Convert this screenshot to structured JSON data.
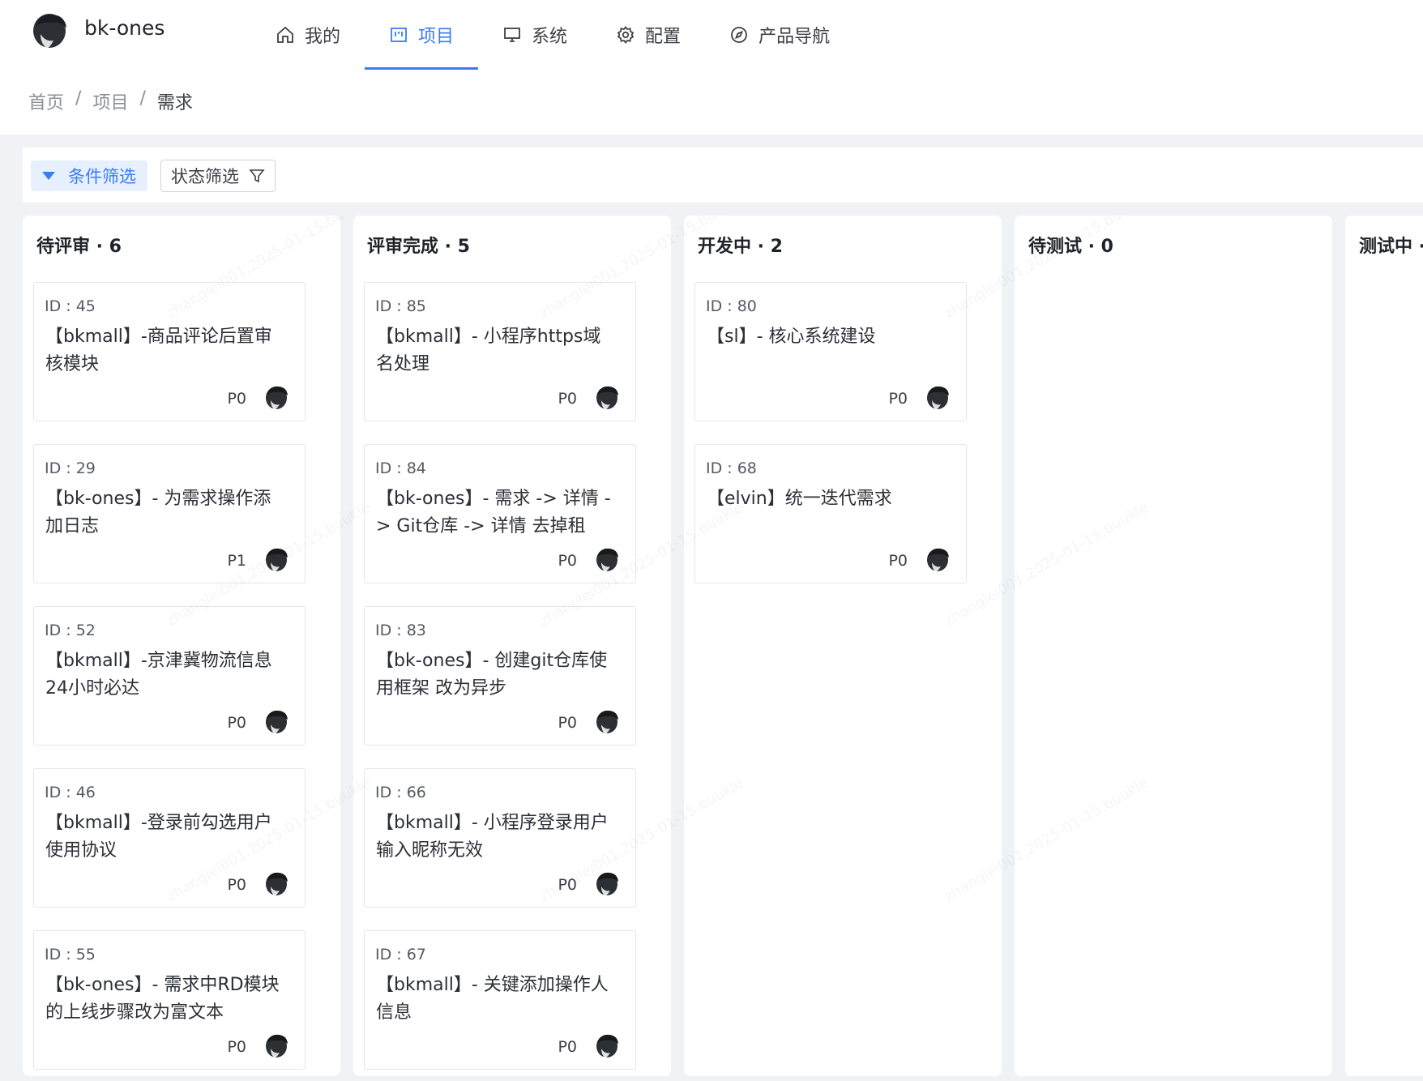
{
  "app": {
    "name": "bk-ones"
  },
  "nav": [
    {
      "label": "我的",
      "icon": "home-icon"
    },
    {
      "label": "项目",
      "icon": "board-icon",
      "active": true
    },
    {
      "label": "系统",
      "icon": "monitor-icon"
    },
    {
      "label": "配置",
      "icon": "gear-icon"
    },
    {
      "label": "产品导航",
      "icon": "compass-icon"
    }
  ],
  "breadcrumb": {
    "home": "首页",
    "project": "项目",
    "current": "需求",
    "sep": "/"
  },
  "filters": {
    "condition": "条件筛选",
    "state": "状态筛选"
  },
  "watermark": "zhanglei001,2025-01-15,buukle",
  "columns": [
    {
      "title": "待评审 · 6",
      "cards": [
        {
          "id": "ID : 45",
          "title": "【bkmall】-商品评论后置审核模块",
          "priority": "P0"
        },
        {
          "id": "ID : 29",
          "title": "【bk-ones】- 为需求操作添加日志",
          "priority": "P1"
        },
        {
          "id": "ID : 52",
          "title": "【bkmall】-京津冀物流信息24小时必达",
          "priority": "P0"
        },
        {
          "id": "ID : 46",
          "title": "【bkmall】-登录前勾选用户使用协议",
          "priority": "P0"
        },
        {
          "id": "ID : 55",
          "title": "【bk-ones】- 需求中RD模块的上线步骤改为富文本",
          "priority": "P0"
        }
      ]
    },
    {
      "title": "评审完成 · 5",
      "cards": [
        {
          "id": "ID : 85",
          "title": "【bkmall】- 小程序https域名处理",
          "priority": "P0"
        },
        {
          "id": "ID : 84",
          "title": "【bk-ones】- 需求 -> 详情 -> Git仓库 -> 详情  去掉租",
          "priority": "P0"
        },
        {
          "id": "ID : 83",
          "title": "【bk-ones】- 创建git仓库使用框架 改为异步",
          "priority": "P0"
        },
        {
          "id": "ID : 66",
          "title": "【bkmall】- 小程序登录用户输入昵称无效",
          "priority": "P0"
        },
        {
          "id": "ID : 67",
          "title": "【bkmall】- 关键添加操作人信息",
          "priority": "P0"
        }
      ]
    },
    {
      "title": "开发中 · 2",
      "cards": [
        {
          "id": "ID : 80",
          "title": "【sl】- 核心系统建设",
          "priority": "P0"
        },
        {
          "id": "ID : 68",
          "title": "【elvin】统一迭代需求",
          "priority": "P0"
        }
      ]
    },
    {
      "title": "待测试 · 0",
      "cards": []
    },
    {
      "title": "测试中 ·",
      "cards": []
    }
  ],
  "colors": {
    "accent": "#3a7cf5",
    "accent_bg": "#e6f0ff"
  }
}
